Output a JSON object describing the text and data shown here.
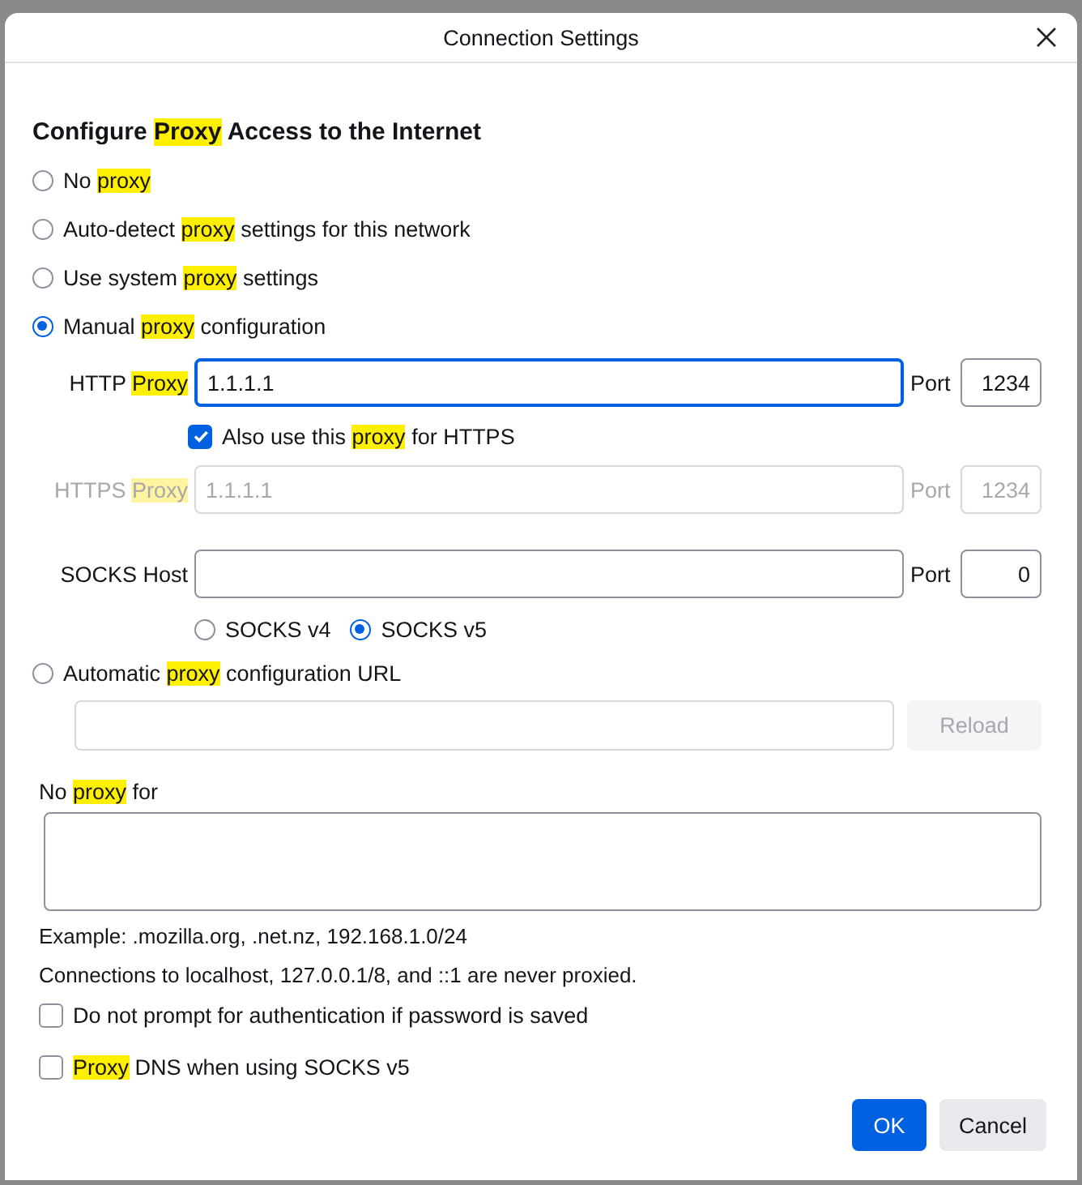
{
  "window": {
    "title": "Connection Settings"
  },
  "heading": [
    {
      "text": "Configure "
    },
    {
      "text": "Proxy",
      "highlighted": true
    },
    {
      "text": " Access to the Internet"
    }
  ],
  "modes": [
    {
      "kind": "plain",
      "selected": false,
      "label": [
        {
          "text": "No "
        },
        {
          "text": "proxy",
          "highlighted": true
        }
      ]
    },
    {
      "kind": "plain",
      "selected": false,
      "label": [
        {
          "text": "Auto-detect "
        },
        {
          "text": "proxy",
          "highlighted": true
        },
        {
          "text": " settings for this network"
        }
      ]
    },
    {
      "kind": "plain",
      "selected": false,
      "label": [
        {
          "text": "Use system "
        },
        {
          "text": "proxy",
          "highlighted": true
        },
        {
          "text": " settings"
        }
      ]
    },
    {
      "kind": "manual",
      "selected": true,
      "label": [
        {
          "text": "Manual "
        },
        {
          "text": "proxy",
          "highlighted": true
        },
        {
          "text": " configuration"
        }
      ]
    },
    {
      "kind": "pac",
      "selected": false,
      "label": [
        {
          "text": "Automatic "
        },
        {
          "text": "proxy",
          "highlighted": true
        },
        {
          "text": " configuration URL"
        }
      ]
    }
  ],
  "manual": {
    "http": {
      "label": [
        {
          "text": "HTTP "
        },
        {
          "text": "Proxy",
          "highlighted": true
        }
      ],
      "value": "1.1.1.1",
      "focused": true,
      "disabled": false,
      "port_label": "Port",
      "port": "1234"
    },
    "also_https": {
      "checked": true,
      "label": [
        {
          "text": "Also use this "
        },
        {
          "text": "proxy",
          "highlighted": true
        },
        {
          "text": " for HTTPS"
        }
      ]
    },
    "https": {
      "label": [
        {
          "text": "HTTPS "
        },
        {
          "text": "Proxy",
          "highlighted": true
        }
      ],
      "value": "1.1.1.1",
      "focused": false,
      "disabled": true,
      "port_label": "Port",
      "port": "1234"
    },
    "socks": {
      "label": [
        {
          "text": "SOCKS Host"
        }
      ],
      "focused": false,
      "disabled": false,
      "port_label": "Port",
      "port": "0"
    },
    "socks_versions": [
      {
        "label": "SOCKS v4",
        "selected": false
      },
      {
        "label": "SOCKS v5",
        "selected": true
      }
    ]
  },
  "pac": {
    "reload": {
      "label": "Reload",
      "disabled": true
    }
  },
  "no_proxy": {
    "label": [
      {
        "text": "No "
      },
      {
        "text": "proxy",
        "highlighted": true
      },
      {
        "text": " for"
      }
    ]
  },
  "example": "Example: .mozilla.org, .net.nz, 192.168.1.0/24",
  "note": "Connections to localhost, 127.0.0.1/8, and ::1 are never proxied.",
  "options": [
    {
      "checked": false,
      "label": [
        {
          "text": "Do not prompt for authentication if password is saved"
        }
      ]
    },
    {
      "checked": false,
      "label": [
        {
          "text": "Proxy",
          "highlighted": true
        },
        {
          "text": " DNS when using SOCKS v5"
        }
      ]
    }
  ],
  "buttons": [
    {
      "label": "OK",
      "kind": "primary"
    },
    {
      "label": "Cancel",
      "kind": "secondary"
    }
  ]
}
